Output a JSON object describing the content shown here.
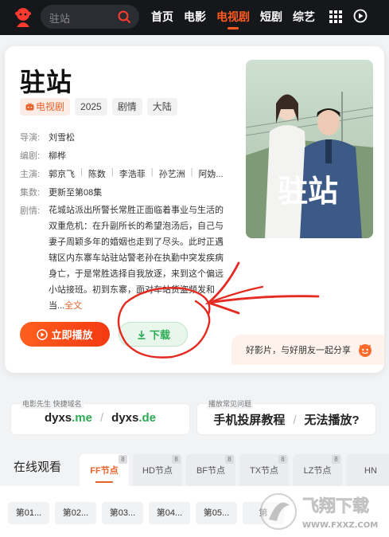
{
  "header": {
    "search_placeholder": "驻站",
    "nav": [
      "首页",
      "电影",
      "电视剧",
      "短剧",
      "综艺"
    ],
    "active_nav": "电视剧",
    "brand_color": "#ff3b2f",
    "accent_color": "#ff5a1f"
  },
  "detail": {
    "title": "驻站",
    "tags": [
      "电视剧",
      "2025",
      "剧情",
      "大陆"
    ],
    "director_label": "导演:",
    "director": "刘雪松",
    "writer_label": "编剧:",
    "writer": "柳桦",
    "cast_label": "主演:",
    "cast": [
      "郭京飞",
      "陈数",
      "李浩菲",
      "孙艺洲",
      "阿妫..."
    ],
    "episodes_label": "集数:",
    "episodes": "更新至第08集",
    "plot_label": "剧情:",
    "plot": "花城站派出所警长常胜正面临着事业与生活的双重危机：在升副所长的希望泡汤后，自己与妻子周颖多年的婚姻也走到了尽头。此时正遇辖区内东寨车站驻站警老孙在执勤中突发疾病身亡，于是常胜选择自我放逐，来到这个偏远小站接班。初到东寨，面对车站货盗频发和当",
    "plot_ellipsis": "...",
    "plot_more": "全文",
    "poster_text": "驻站",
    "play_button": "立即播放",
    "download_button": "下载",
    "share_text": "好影片，与好朋友一起分享"
  },
  "domains": {
    "caption": "电影先生 快捷域名",
    "items": [
      {
        "name": "dyxs",
        "suffix": ".me"
      },
      {
        "name": "dyxs",
        "suffix": ".de"
      }
    ],
    "sep": "/"
  },
  "faq": {
    "caption": "播放常见问题",
    "items": [
      "手机投屏教程",
      "无法播放?"
    ],
    "sep": "/"
  },
  "online": {
    "title": "在线观看",
    "tabs": [
      {
        "label": "FF节点",
        "badge": "8"
      },
      {
        "label": "HD节点",
        "badge": "8"
      },
      {
        "label": "BF节点",
        "badge": "8"
      },
      {
        "label": "TX节点",
        "badge": "8"
      },
      {
        "label": "LZ节点",
        "badge": "8"
      },
      {
        "label": "HN",
        "badge": ""
      }
    ],
    "episodes": [
      "第01...",
      "第02...",
      "第03...",
      "第04...",
      "第05...",
      "第"
    ]
  },
  "watermark": {
    "text": "飞翔下载",
    "url": "WWW.FXXZ.COM"
  }
}
